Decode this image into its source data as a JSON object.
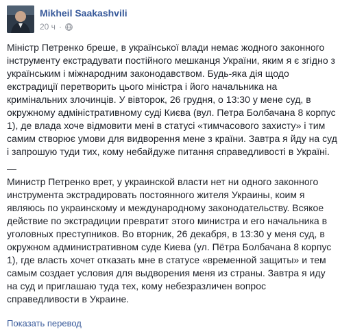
{
  "post": {
    "author": "Mikheil Saakashvili",
    "time": "20 ч",
    "separator": "·",
    "privacy_icon": "globe-icon",
    "paragraphs": [
      "Міністр Петренко бреше, в української влади немає жодного законного інструменту екстрадувати постійного мешканця України, яким я є згідно з українським і міжнародним законодавством. Будь-яка дія щодо екстрадиції перетворить цього міністра і його начальника на кримінальних злочинців. У вівторок, 26 грудня, о 13:30 у мене суд, в окружному адміністративному суді Києва (вул. Петра Болбачана 8 корпус 1), де влада хоче відмовити мені в статусі «тимчасового захисту» і тим самим створює умови для видворення мене з країни. Завтра я йду на суд і запрошую туди тих, кому небайдуже питання справедливості в Україні.",
      "—\nМинистр Петренко врет, у украинской власти нет ни одного законного инструмента экстрадировать постоянного жителя Украины, коим я являюсь по украинскому и международному законодательству. Всякое действие по экстрадиции превратит этого министра и его начальника в уголовных преступников. Во вторник, 26 декабря, в 13:30 у меня суд, в окружном административном суде Киева (ул. Пётра Болбачана 8 корпус 1), где власть хочет отказать мне в статусе «временной защиты» и тем самым создает условия для выдворения меня из страны. Завтра я иду на суд и приглашаю туда тех, кому небезразличен вопрос справедливости в Украине."
    ],
    "translate_link": "Показать перевод"
  },
  "colors": {
    "link": "#365899",
    "text": "#1d2129",
    "muted": "#90949c"
  }
}
